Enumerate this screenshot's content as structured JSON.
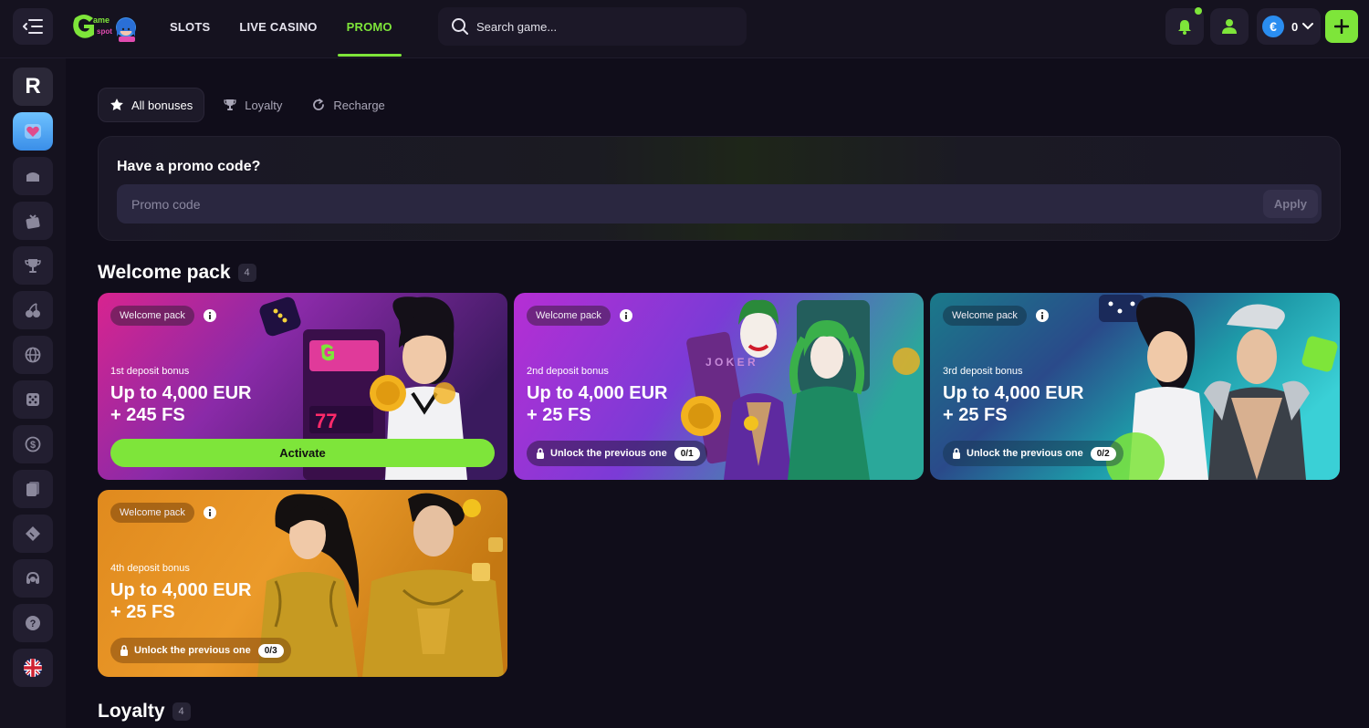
{
  "header": {
    "nav": [
      "SLOTS",
      "LIVE CASINO",
      "PROMO"
    ],
    "search_placeholder": "Search game...",
    "balance": "0",
    "currency_symbol": "€"
  },
  "sidebar": {
    "avatar_letter": "R"
  },
  "tabs": [
    "All bonuses",
    "Loyalty",
    "Recharge"
  ],
  "promo": {
    "title": "Have a promo code?",
    "placeholder": "Promo code",
    "apply": "Apply"
  },
  "welcome": {
    "title": "Welcome pack",
    "count": "4",
    "cards": [
      {
        "tag": "Welcome pack",
        "subtitle": "1st deposit bonus",
        "line1": "Up to 4,000 EUR",
        "line2": "+ 245 FS",
        "action": "Activate"
      },
      {
        "tag": "Welcome pack",
        "subtitle": "2nd deposit bonus",
        "line1": "Up to 4,000 EUR",
        "line2": "+ 25 FS",
        "lock_text": "Unlock the previous one",
        "progress": "0/1"
      },
      {
        "tag": "Welcome pack",
        "subtitle": "3rd deposit bonus",
        "line1": "Up to 4,000 EUR",
        "line2": "+ 25 FS",
        "lock_text": "Unlock the previous one",
        "progress": "0/2"
      },
      {
        "tag": "Welcome pack",
        "subtitle": "4th deposit bonus",
        "line1": "Up to 4,000 EUR",
        "line2": "+ 25 FS",
        "lock_text": "Unlock the previous one",
        "progress": "0/3"
      }
    ]
  },
  "loyalty": {
    "title": "Loyalty",
    "count": "4"
  },
  "colors": {
    "accent": "#7ee53a",
    "background": "#100d1a",
    "panel": "#15121f"
  }
}
